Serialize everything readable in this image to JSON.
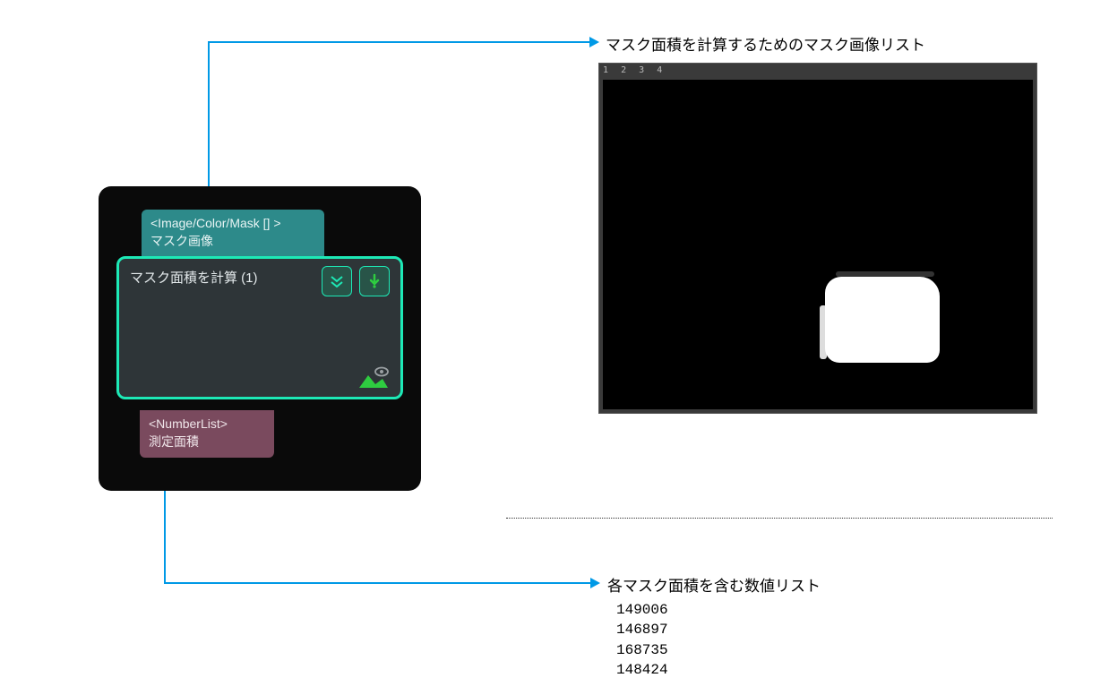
{
  "annotations": {
    "top_label": "マスク面積を計算するためのマスク画像リスト",
    "bottom_label": "各マスク面積を含む数値リスト"
  },
  "node": {
    "input_type": "<Image/Color/Mask [] >",
    "input_label": "マスク画像",
    "title": "マスク面積を計算 (1)",
    "output_type": "<NumberList>",
    "output_label": "測定面積"
  },
  "mask_window": {
    "tabs": [
      "1",
      "2",
      "3",
      "4"
    ]
  },
  "output_values": [
    149006,
    146897,
    168735,
    148424
  ]
}
